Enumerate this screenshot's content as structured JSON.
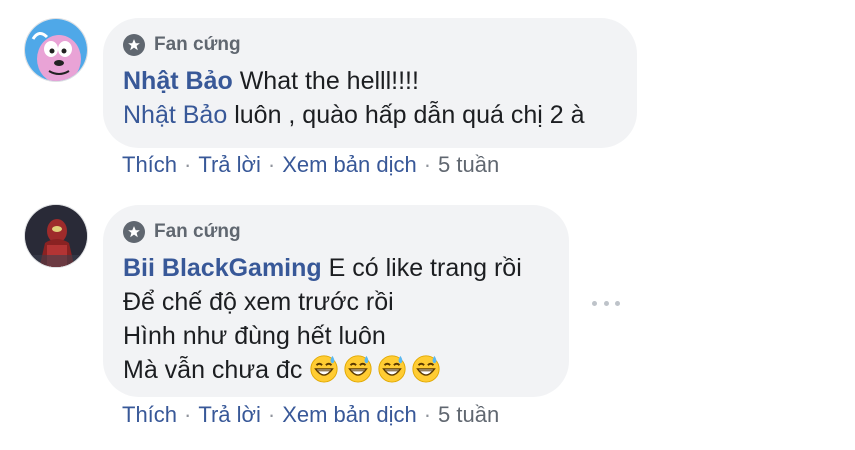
{
  "comments": [
    {
      "badge": "Fan cứng",
      "author": "Nhật Bảo",
      "lines": [
        "What the helll!!!!",
        "luôn , quào hấp dẫn quá chị 2 à"
      ],
      "mention": "Nhật Bảo",
      "actions": {
        "like": "Thích",
        "reply": "Trả lời",
        "translate": "Xem bản dịch",
        "time": "5 tuần"
      },
      "separator": "·"
    },
    {
      "badge": "Fan cứng",
      "author": "Bii BlackGaming",
      "lines": [
        "E có like trang rồi",
        "Để chế độ xem trước rồi",
        "Hình như đùng hết luôn",
        "Mà vẫn chưa đc"
      ],
      "emoji": [
        "grinning-sweat-emoji",
        "grinning-sweat-emoji",
        "grinning-sweat-emoji",
        "grinning-sweat-emoji"
      ],
      "actions": {
        "like": "Thích",
        "reply": "Trả lời",
        "translate": "Xem bản dịch",
        "time": "5 tuần"
      },
      "separator": "·"
    }
  ],
  "colors": {
    "link": "#385898",
    "bubble": "#f2f3f5",
    "meta": "#606770"
  }
}
